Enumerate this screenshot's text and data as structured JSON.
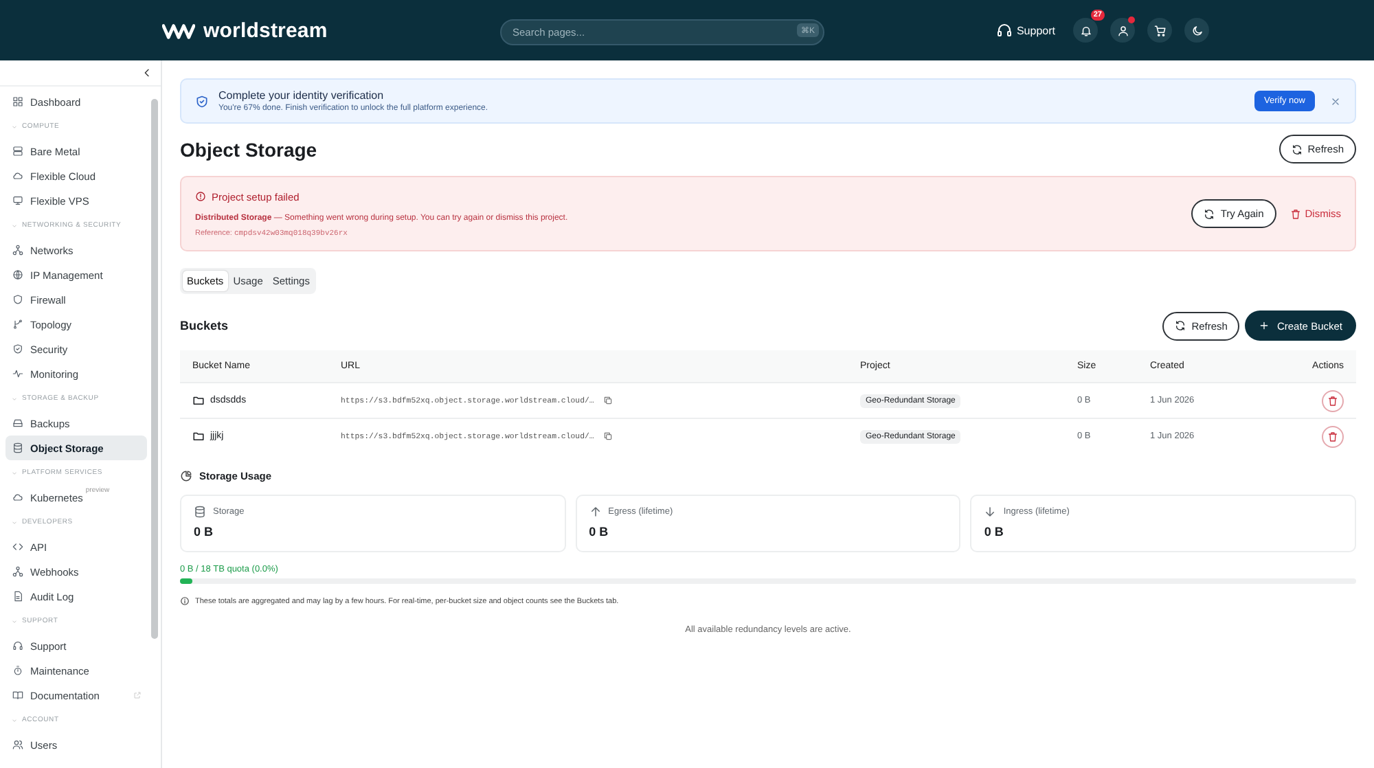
{
  "header": {
    "logo": "worldstream",
    "search": {
      "placeholder": "Search pages...",
      "shortcut": "⌘K"
    },
    "support": "Support",
    "notifications": "27",
    "account_dot": true
  },
  "sidebar": {
    "sections": [
      {
        "items": [
          {
            "label": "Dashboard",
            "selected": false
          }
        ]
      },
      {
        "heading": "COMPUTE",
        "items": [
          {
            "label": "Bare Metal",
            "selected": false
          },
          {
            "label": "Flexible Cloud",
            "selected": false
          },
          {
            "label": "Flexible VPS",
            "selected": false
          }
        ]
      },
      {
        "heading": "NETWORKING & SECURITY",
        "items": [
          {
            "label": "Networks",
            "selected": false
          },
          {
            "label": "IP Management",
            "selected": false
          },
          {
            "label": "Firewall",
            "selected": false
          },
          {
            "label": "Topology",
            "selected": false
          },
          {
            "label": "Security",
            "selected": false
          },
          {
            "label": "Monitoring",
            "selected": false
          }
        ]
      },
      {
        "heading": "STORAGE & BACKUP",
        "items": [
          {
            "label": "Backups",
            "selected": false
          },
          {
            "label": "Object Storage",
            "selected": true
          }
        ]
      },
      {
        "heading": "PLATFORM SERVICES",
        "items": [
          {
            "label": "Kubernetes",
            "selected": false,
            "badge": "preview"
          }
        ]
      },
      {
        "heading": "DEVELOPERS",
        "items": [
          {
            "label": "API",
            "selected": false
          },
          {
            "label": "Webhooks",
            "selected": false
          },
          {
            "label": "Audit Log",
            "selected": false
          }
        ]
      },
      {
        "heading": "SUPPORT",
        "items": [
          {
            "label": "Support",
            "selected": false
          },
          {
            "label": "Maintenance",
            "selected": false
          },
          {
            "label": "Documentation",
            "selected": false,
            "external": true
          }
        ]
      },
      {
        "heading": "ACCOUNT",
        "items": [
          {
            "label": "Users",
            "selected": false
          }
        ]
      }
    ]
  },
  "banner": {
    "title": "Complete your identity verification",
    "text": "You're 67% done. Finish verification to unlock the full platform experience.",
    "button": "Verify now"
  },
  "page_title": "Object Storage",
  "refresh": "Refresh",
  "error": {
    "title": "Project setup failed",
    "message": "**Distributed Storage** — Something went wrong during setup. You can try again or dismiss this project.",
    "reference_label": "Reference:",
    "reference": "cmpdsv42w03mq018q39bv26rx",
    "retry": "Try Again",
    "dismiss": "Dismiss"
  },
  "tabs": [
    {
      "label": "Buckets",
      "selected": true
    },
    {
      "label": "Usage",
      "selected": false
    },
    {
      "label": "Settings",
      "selected": false
    }
  ],
  "buckets": {
    "title": "Buckets",
    "refresh": "Refresh",
    "create": "Create Bucket",
    "columns": [
      "Bucket Name",
      "URL",
      "Project",
      "Size",
      "Created",
      "Actions"
    ],
    "rows": [
      {
        "name": "dsdsdds",
        "url": "https://s3.bdfm52xq.object.storage.worldstream.cloud/…",
        "project": "Geo-Redundant Storage",
        "size": "0 B",
        "created": "1 Jun 2026"
      },
      {
        "name": "jjjkj",
        "url": "https://s3.bdfm52xq.object.storage.worldstream.cloud/…",
        "project": "Geo-Redundant Storage",
        "size": "0 B",
        "created": "1 Jun 2026"
      }
    ]
  },
  "usage": {
    "title": "Storage Usage",
    "cards": [
      {
        "label": "Storage",
        "value": "0 B"
      },
      {
        "label": "Egress (lifetime)",
        "value": "0 B"
      },
      {
        "label": "Ingress (lifetime)",
        "value": "0 B"
      }
    ],
    "quota": "0 B / 18 TB quota (0.0%)",
    "level": 0.01,
    "note": "These totals are aggregated and may lag by a few hours. For real-time, per-bucket size and object counts see the Buckets tab.",
    "footer": "All available redundancy levels are active."
  }
}
